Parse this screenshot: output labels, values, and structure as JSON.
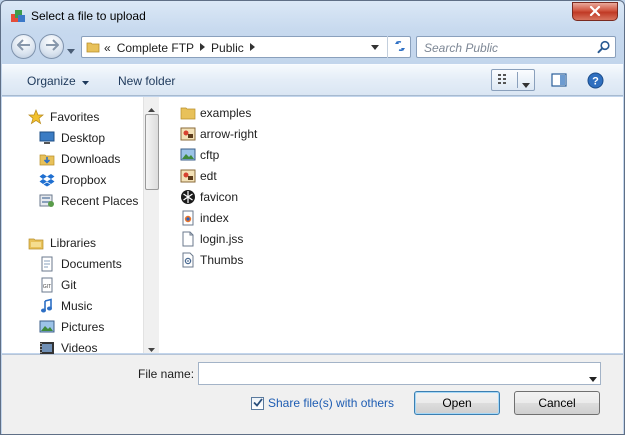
{
  "window": {
    "title": "Select a file to upload"
  },
  "address": {
    "overflow": "«",
    "crumbs": [
      "Complete FTP",
      "Public"
    ],
    "search_placeholder": "Search Public"
  },
  "toolbar": {
    "organize_label": "Organize",
    "new_folder_label": "New folder"
  },
  "nav": {
    "favorites": {
      "label": "Favorites",
      "items": [
        {
          "label": "Desktop",
          "icon": "desktop-icon"
        },
        {
          "label": "Downloads",
          "icon": "downloads-folder-icon"
        },
        {
          "label": "Dropbox",
          "icon": "dropbox-icon"
        },
        {
          "label": "Recent Places",
          "icon": "recent-places-icon"
        }
      ]
    },
    "libraries": {
      "label": "Libraries",
      "items": [
        {
          "label": "Documents",
          "icon": "documents-icon"
        },
        {
          "label": "Git",
          "icon": "git-icon"
        },
        {
          "label": "Music",
          "icon": "music-icon"
        },
        {
          "label": "Pictures",
          "icon": "pictures-icon"
        },
        {
          "label": "Videos",
          "icon": "videos-icon"
        }
      ]
    }
  },
  "files": [
    {
      "name": "examples",
      "icon": "folder-icon"
    },
    {
      "name": "arrow-right",
      "icon": "image-file-icon"
    },
    {
      "name": "cftp",
      "icon": "picture-file-icon"
    },
    {
      "name": "edt",
      "icon": "image-file-icon"
    },
    {
      "name": "favicon",
      "icon": "favicon-icon"
    },
    {
      "name": "index",
      "icon": "html-file-icon"
    },
    {
      "name": "login.jss",
      "icon": "blank-file-icon"
    },
    {
      "name": "Thumbs",
      "icon": "system-file-icon"
    }
  ],
  "footer": {
    "file_name_label": "File name:",
    "file_name_value": "",
    "share_label": "Share file(s) with others",
    "share_checked": true,
    "open_label": "Open",
    "cancel_label": "Cancel"
  },
  "colors": {
    "accent": "#1e5db3",
    "close": "#c03a25",
    "folder": "#e8c15a"
  }
}
